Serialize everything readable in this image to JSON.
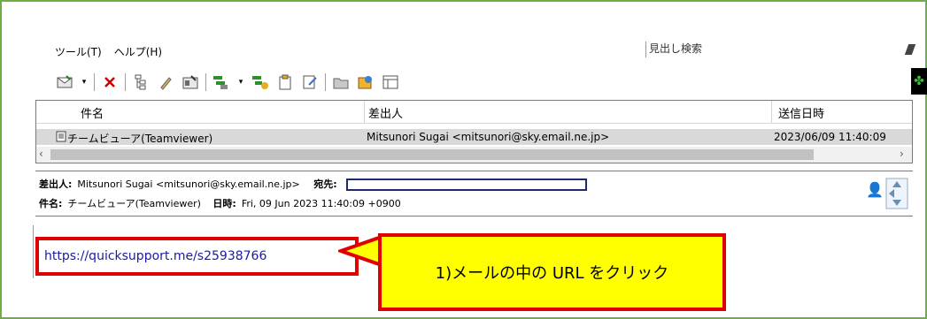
{
  "menu": {
    "items": [
      "ツール(T)",
      "ヘルプ(H)"
    ]
  },
  "search": {
    "label": "見出し検索"
  },
  "list": {
    "columns": [
      "件名",
      "差出人",
      "送信日時"
    ],
    "row": {
      "subject": "チームビューア(Teamviewer)",
      "from": "Mitsunori Sugai <mitsunori@sky.email.ne.jp>",
      "sent": "2023/06/09 11:40:09"
    }
  },
  "preview": {
    "from_label": "差出人:",
    "from_value": "Mitsunori Sugai <mitsunori@sky.email.ne.jp>",
    "to_label": "宛先:",
    "subject_label": "件名:",
    "subject_value": "チームビューア(Teamviewer)",
    "date_label": "日時:",
    "date_value": "Fri, 09 Jun 2023 11:40:09 +0900"
  },
  "body": {
    "link": "https://quicksupport.me/s25938766"
  },
  "callout": {
    "text": "1)メールの中の URL をクリック"
  },
  "colors": {
    "accent_red": "#e00000",
    "callout_yellow": "#ffff00",
    "frame_green": "#70ad47",
    "link_blue": "#1a1aa6"
  }
}
